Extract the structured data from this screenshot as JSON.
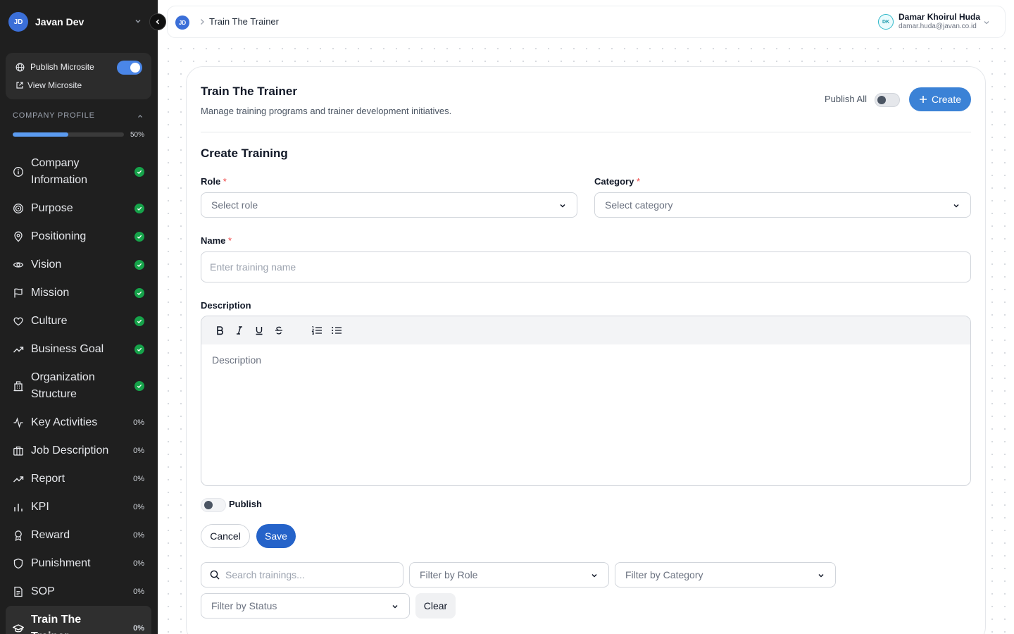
{
  "workspace": {
    "initials": "JD",
    "name": "Javan Dev"
  },
  "microsite": {
    "publish_label": "Publish Microsite",
    "publish_on": true,
    "view_label": "View Microsite"
  },
  "company_profile": {
    "label": "COMPANY PROFILE",
    "progress_text": "50%",
    "progress_fraction": 0.5
  },
  "nav": {
    "items": [
      {
        "label": "Company Information",
        "status": "done",
        "icon": "info-icon"
      },
      {
        "label": "Purpose",
        "status": "done",
        "icon": "target-icon"
      },
      {
        "label": "Positioning",
        "status": "done",
        "icon": "map-pin-icon"
      },
      {
        "label": "Vision",
        "status": "done",
        "icon": "eye-icon"
      },
      {
        "label": "Mission",
        "status": "done",
        "icon": "flag-icon"
      },
      {
        "label": "Culture",
        "status": "done",
        "icon": "heart-icon"
      },
      {
        "label": "Business Goal",
        "status": "done",
        "icon": "trend-icon"
      },
      {
        "label": "Organization Structure",
        "status": "done",
        "icon": "building-icon"
      },
      {
        "label": "Key Activities",
        "status": "0%",
        "icon": "activity-icon"
      },
      {
        "label": "Job Description",
        "status": "0%",
        "icon": "briefcase-icon"
      },
      {
        "label": "Report",
        "status": "0%",
        "icon": "trend-icon"
      },
      {
        "label": "KPI",
        "status": "0%",
        "icon": "bar-chart-icon"
      },
      {
        "label": "Reward",
        "status": "0%",
        "icon": "award-icon"
      },
      {
        "label": "Punishment",
        "status": "0%",
        "icon": "shield-icon"
      },
      {
        "label": "SOP",
        "status": "0%",
        "icon": "file-icon"
      },
      {
        "label": "Train The Trainer",
        "status": "0%",
        "icon": "graduation-cap-icon",
        "active": true
      }
    ]
  },
  "topbar": {
    "avatar": "JD",
    "breadcrumb": "Train The Trainer",
    "user": {
      "initials": "DK",
      "name": "Damar Khoirul Huda",
      "email": "damar.huda@javan.co.id"
    }
  },
  "page": {
    "title": "Train The Trainer",
    "subtitle": "Manage training programs and trainer development initiatives.",
    "publish_all_label": "Publish All",
    "create_label": "Create"
  },
  "form": {
    "title": "Create Training",
    "role_label": "Role",
    "role_placeholder": "Select role",
    "category_label": "Category",
    "category_placeholder": "Select category",
    "required_mark": "*",
    "name_label": "Name",
    "name_placeholder": "Enter training name",
    "description_label": "Description",
    "description_placeholder": "Description",
    "publish_label": "Publish",
    "cancel_label": "Cancel",
    "save_label": "Save"
  },
  "filters": {
    "search_placeholder": "Search trainings...",
    "role": "Filter by Role",
    "category": "Filter by Category",
    "status": "Filter by Status",
    "clear_label": "Clear"
  }
}
